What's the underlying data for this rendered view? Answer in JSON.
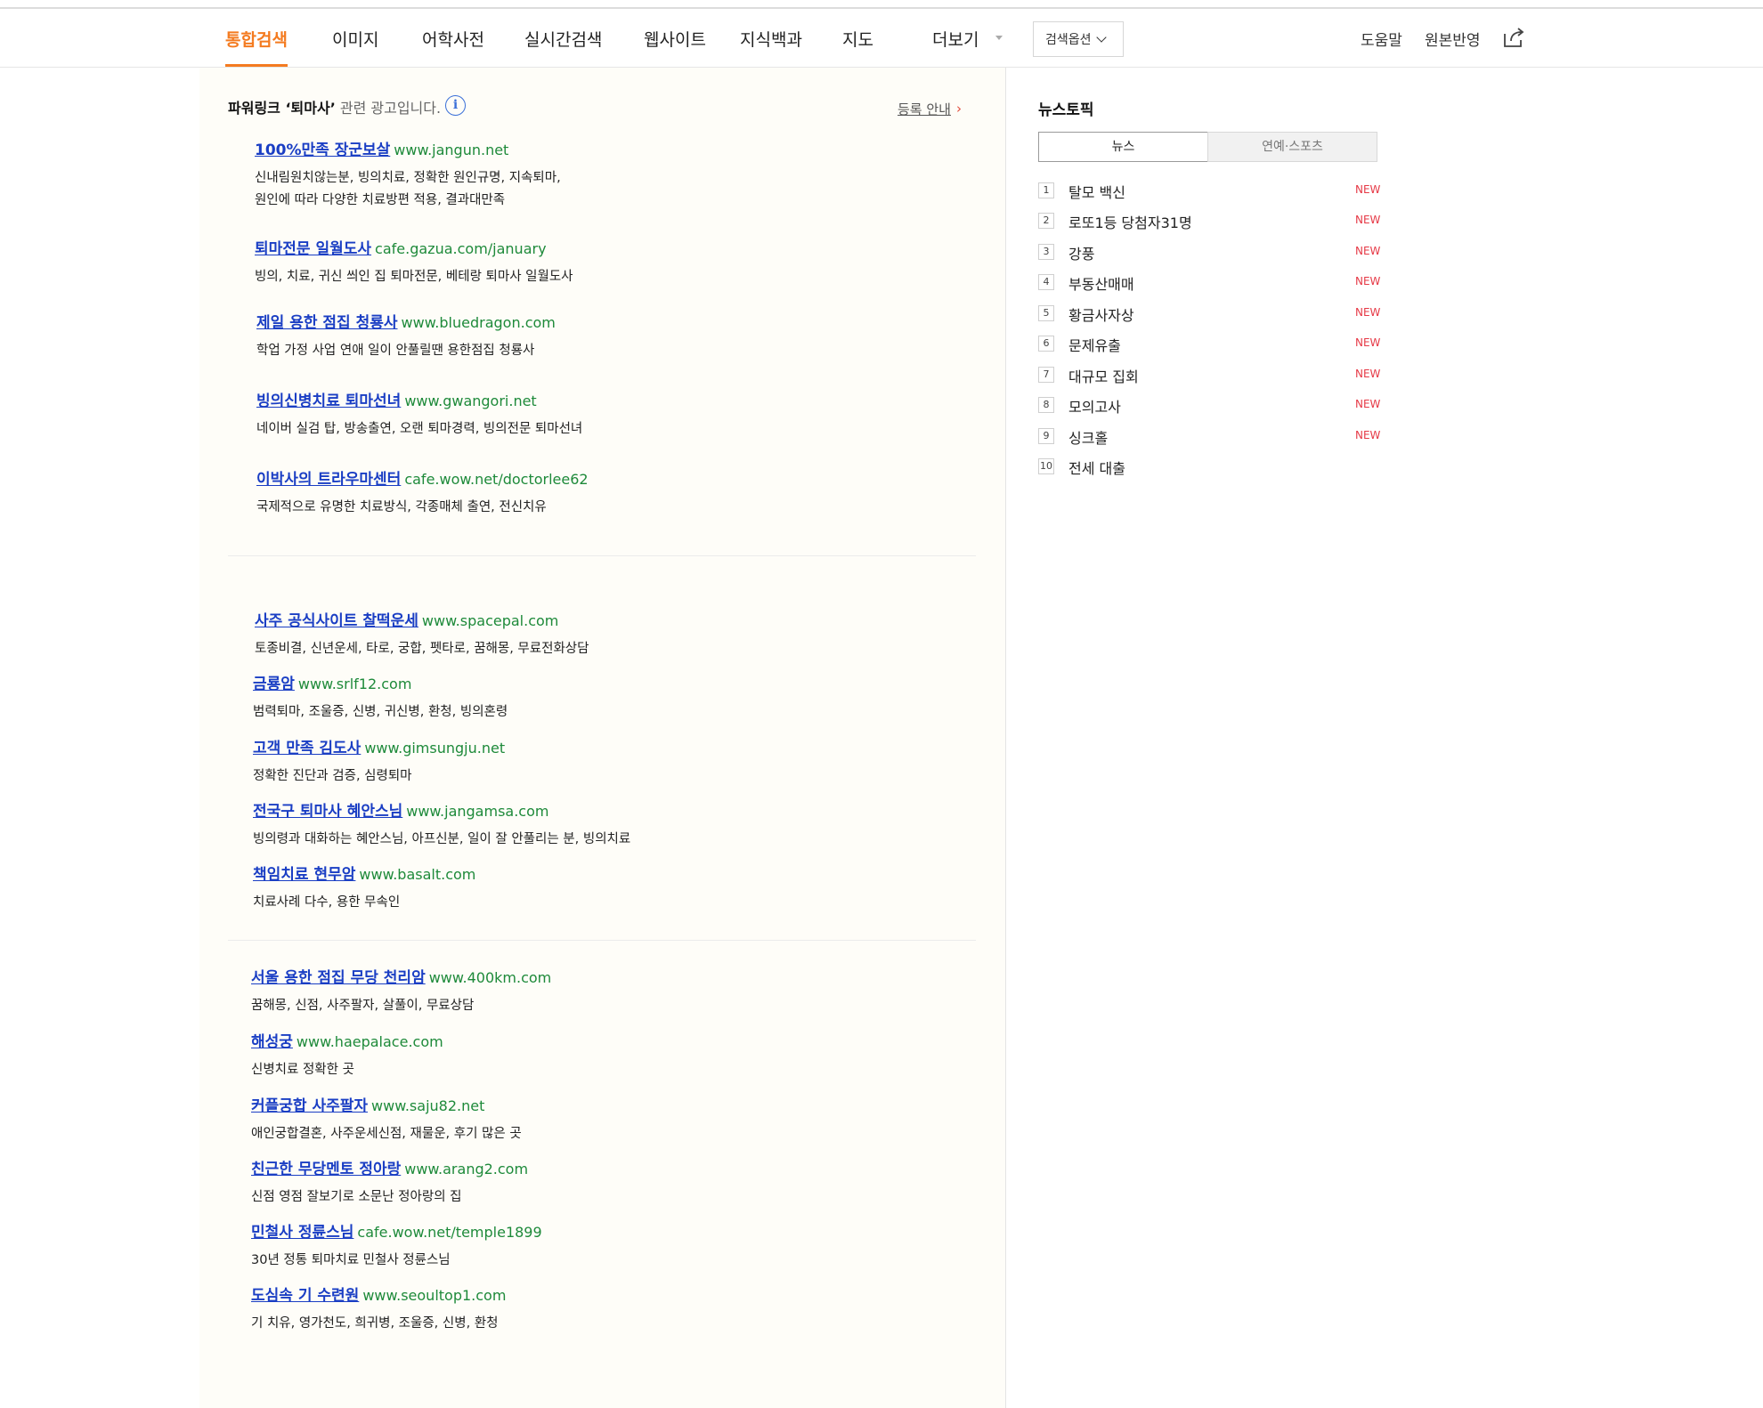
{
  "nav": {
    "tabs": [
      {
        "label": "통합검색",
        "active": true
      },
      {
        "label": "이미지"
      },
      {
        "label": "어학사전"
      },
      {
        "label": "실시간검색"
      },
      {
        "label": "웹사이트"
      },
      {
        "label": "지식백과"
      },
      {
        "label": "지도"
      },
      {
        "label": "더보기"
      }
    ],
    "search_option": "검색옵션",
    "help": "도움말",
    "feedback": "원본반영",
    "share_icon": "share-icon"
  },
  "ads": {
    "header_strong": "파워링크 ‘퇴마사’",
    "header_sub": "관련 광고입니다.",
    "info_icon": "i",
    "register": "등록 안내",
    "register_arrow": "›",
    "group1": [
      {
        "title": "100%만족 장군보살",
        "url": "www.jangun.net",
        "desc": [
          "신내림원치않는분, 빙의치료, 정확한 원인규명, 지속퇴마,",
          "원인에 따라 다양한 치료방편 적용, 결과대만족"
        ]
      },
      {
        "title": "퇴마전문 일월도사",
        "url": "cafe.gazua.com/january",
        "desc": [
          "빙의, 치료, 귀신 씌인 집 퇴마전문, 베테랑 퇴마사 일월도사"
        ]
      },
      {
        "title": "제일 용한 점집 청룡사",
        "url": "www.bluedragon.com",
        "desc": [
          "학업 가정 사업 연애 일이 안풀릴땐 용한점집 청룡사"
        ]
      },
      {
        "title": "빙의신병치료 퇴마선녀",
        "url": "www.gwangori.net",
        "desc": [
          "네이버 실검 탑, 방송출연, 오랜 퇴마경력, 빙의전문 퇴마선녀"
        ]
      },
      {
        "title": "이박사의 트라우마센터",
        "url": "cafe.wow.net/doctorlee62",
        "desc": [
          "국제적으로 유명한 치료방식, 각종매체 출연, 전신치유"
        ]
      }
    ],
    "group2": [
      {
        "title": "사주 공식사이트 찰떡운세",
        "url": "www.spacepal.com",
        "desc": [
          "토종비결, 신년운세, 타로, 궁합, 펫타로, 꿈해몽, 무료전화상담"
        ]
      },
      {
        "title": "금룡암",
        "url": "www.srlf12.com",
        "desc": [
          "범력퇴마, 조울증, 신병, 귀신병, 환청, 빙의혼령"
        ]
      },
      {
        "title": "고객 만족 김도사",
        "url": "www.gimsungju.net",
        "desc": [
          "정확한 진단과 검증, 심령퇴마"
        ]
      },
      {
        "title": "전국구 퇴마사 혜안스님",
        "url": "www.jangamsa.com",
        "desc": [
          "빙의령과 대화하는 혜안스님, 아프신분, 일이 잘 안풀리는 분, 빙의치료"
        ]
      },
      {
        "title": "책임치료 현무암",
        "url": "www.basalt.com",
        "desc": [
          "치료사례 다수, 용한 무속인"
        ]
      }
    ],
    "group3": [
      {
        "title": "서울 용한 점집 무당 천리암",
        "url": "www.400km.com",
        "desc": [
          "꿈해몽, 신점, 사주팔자, 살풀이, 무료상담"
        ]
      },
      {
        "title": "해성궁",
        "url": "www.haepalace.com",
        "desc": [
          "신병치료 정확한 곳"
        ]
      },
      {
        "title": "커플궁합 사주팔자",
        "url": "www.saju82.net",
        "desc": [
          "애인궁합결혼, 사주운세신점, 재물운, 후기 많은 곳"
        ]
      },
      {
        "title": "친근한 무당멘토 정아랑",
        "url": "www.arang2.com",
        "desc": [
          "신점 영점 잘보기로 소문난 정아랑의 집"
        ]
      },
      {
        "title": "민철사 정륜스님",
        "url": "cafe.wow.net/temple1899",
        "desc": [
          "30년 정통 퇴마치료 민철사 정륜스님"
        ]
      },
      {
        "title": "도심속 기 수련원",
        "url": "www.seoultop1.com",
        "desc": [
          "기 치유, 영가천도, 희귀병, 조울증, 신병, 환청"
        ]
      }
    ]
  },
  "news": {
    "title": "뉴스토픽",
    "tabs": [
      "뉴스",
      "연예·스포츠"
    ],
    "new_label": "NEW",
    "items": [
      {
        "rank": "1",
        "keyword": "탈모 백신",
        "new": true
      },
      {
        "rank": "2",
        "keyword": "로또1등 당첨자31명",
        "new": true
      },
      {
        "rank": "3",
        "keyword": "강풍",
        "new": true
      },
      {
        "rank": "4",
        "keyword": "부동산매매",
        "new": true
      },
      {
        "rank": "5",
        "keyword": "황금사자상",
        "new": true
      },
      {
        "rank": "6",
        "keyword": "문제유출",
        "new": true
      },
      {
        "rank": "7",
        "keyword": "대규모 집회",
        "new": true
      },
      {
        "rank": "8",
        "keyword": "모의고사",
        "new": true
      },
      {
        "rank": "9",
        "keyword": "싱크홀",
        "new": true
      },
      {
        "rank": "10",
        "keyword": "전세 대출",
        "new": false
      }
    ]
  },
  "colors": {
    "accent": "#f47b20",
    "ad_title": "#1a3ec4",
    "ad_url": "#1e8a3a",
    "new": "#e63946",
    "panel_bg": "#fefdf8"
  }
}
